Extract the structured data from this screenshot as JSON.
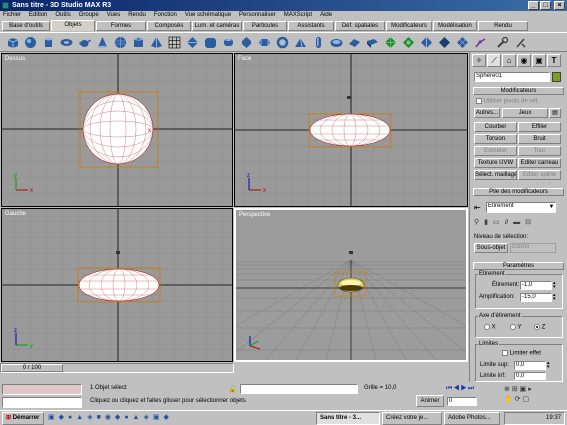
{
  "window": {
    "title": "Sans titre - 3D Studio MAX R3"
  },
  "menu": [
    "Fichier",
    "Edition",
    "Outils",
    "Groupe",
    "Vues",
    "Rendu",
    "Fonction",
    "Vue schématique",
    "Personnaliser",
    "MAXScript",
    "Aide"
  ],
  "tabs": [
    "Base d'outils",
    "Objets",
    "Formes",
    "Composés",
    "Lum. et caméras",
    "Particules",
    "Assistants",
    "Déf. spatiales",
    "Modificateurs",
    "Modélisation",
    "Rendu"
  ],
  "viewports": {
    "top_left": "Dessus",
    "top_right": "Face",
    "bottom_left": "Gauche",
    "bottom_right": "Perspective"
  },
  "panel": {
    "object_name": "Sphère01",
    "modifiers_header": "Modificateurs",
    "modifiers_checkbox": "Utiliser pivots de sél.",
    "btn_autres": "Autres...",
    "btn_jeux": "Jeux",
    "btn_courber": "Courber",
    "btn_effiler": "Effiler",
    "btn_torsion": "Torsion",
    "btn_bruit": "Bruit",
    "btn_extruder": "Extruder",
    "btn_tour": "Tour",
    "btn_texture_uvw": "Texture UVW",
    "btn_editer_carreau": "Editer carreau",
    "btn_select_maillage": "Sélect. maillage",
    "btn_editer_spline": "Editer spline",
    "stack_header": "Pile des modificateurs",
    "stack_value": "Étirement",
    "selection_level": "Niveau de sélection:",
    "sub_object": "Sous-objet",
    "sub_object_value": "Gizmo",
    "params_header": "Paramètres",
    "group_etirement": "Etirement",
    "field_etirement_label": "Étirement:",
    "field_etirement_value": "-1,0",
    "field_amplification_label": "Amplification:",
    "field_amplification_value": "-15,0",
    "group_axe": "Axe d'étirement",
    "axis_x": "X",
    "axis_y": "Y",
    "axis_z": "Z",
    "group_limites": "Limites",
    "limit_effect": "Limiter effet",
    "limit_sup_label": "Limite sup:",
    "limit_sup_value": "0,0",
    "limit_inf_label": "Limite inf:",
    "limit_inf_value": "0,0"
  },
  "timeslider": "0 / 100",
  "status": {
    "selection": "1 Objet sélect",
    "prompt": "Cliquez ou cliquez et faites glisser pour sélectionner objets",
    "grid": "Grille = 10,0",
    "animate": "Animer",
    "frame": "0"
  },
  "taskbar": {
    "start": "Démarrer",
    "task1": "Sans titre - 3...",
    "task2": "Créez votre je...",
    "task3": "Adobe Photos...",
    "clock": "19:37"
  }
}
